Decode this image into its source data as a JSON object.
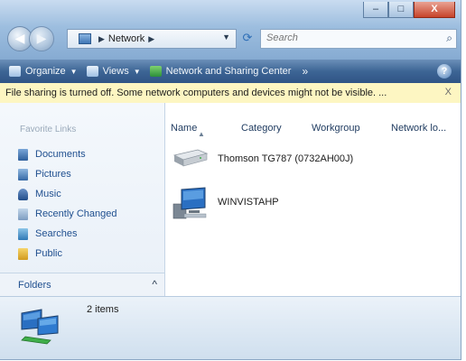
{
  "window": {
    "caption_buttons": {
      "minimize": "–",
      "maximize": "□",
      "close": "X"
    }
  },
  "nav": {
    "back_glyph": "◀",
    "forward_glyph": "▶",
    "address": {
      "separator": "▶",
      "location": "Network",
      "trailing_separator": "▶",
      "dropdown_glyph": "▼"
    },
    "refresh_glyph": "⟳",
    "search": {
      "placeholder": "Search",
      "icon": "search-icon"
    }
  },
  "command_bar": {
    "organize": {
      "label": "Organize",
      "icon": "organize-icon"
    },
    "views": {
      "label": "Views",
      "icon": "views-icon"
    },
    "network_center": {
      "label": "Network and Sharing Center",
      "icon": "network-center-icon"
    },
    "more_glyph": "»",
    "help_glyph": "?"
  },
  "infobar": {
    "text": "File sharing is turned off. Some network computers and devices might not be visible. ...",
    "close_glyph": "X"
  },
  "navpane": {
    "title": "Favorite Links",
    "links": [
      {
        "label": "Documents",
        "icon": "documents-icon"
      },
      {
        "label": "Pictures",
        "icon": "pictures-icon"
      },
      {
        "label": "Music",
        "icon": "music-icon"
      },
      {
        "label": "Recently Changed",
        "icon": "recently-changed-icon"
      },
      {
        "label": "Searches",
        "icon": "searches-icon"
      },
      {
        "label": "Public",
        "icon": "public-folder-icon"
      }
    ],
    "folders_label": "Folders",
    "folders_toggle": "^"
  },
  "content": {
    "columns": [
      "Name",
      "Category",
      "Workgroup",
      "Network lo..."
    ],
    "items": [
      {
        "name": "Thomson TG787 (0732AH00J)",
        "icon": "router-device-icon"
      },
      {
        "name": "WINVISTAHP",
        "icon": "computer-icon"
      }
    ]
  },
  "details": {
    "icon": "network-computers-icon",
    "count_text": "2 items"
  },
  "colors": {
    "frame": "#9dbedf",
    "command_bar": "#3d6595",
    "infobar": "#fdf6c2",
    "link_text": "#1f4f8f"
  }
}
